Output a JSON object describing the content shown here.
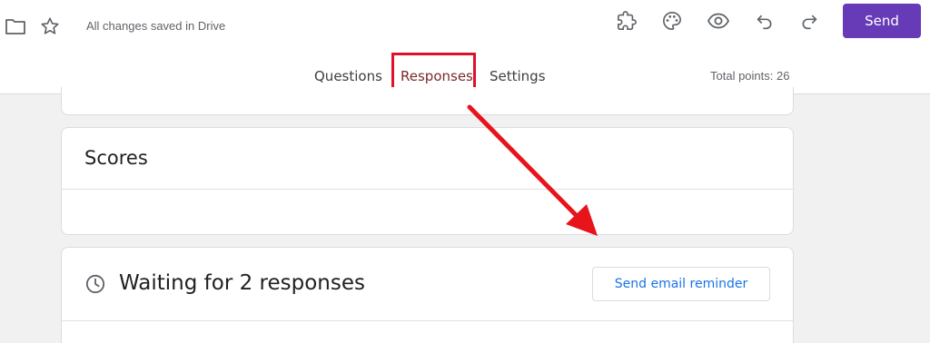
{
  "header": {
    "saved_status": "All changes saved in Drive",
    "send_label": "Send",
    "accent_color": "#673ab7"
  },
  "tabs": [
    {
      "label": "Questions",
      "active": false
    },
    {
      "label": "Responses",
      "active": true
    },
    {
      "label": "Settings",
      "active": false
    }
  ],
  "total_points": "Total points: 26",
  "scores": {
    "title": "Scores"
  },
  "waiting": {
    "title": "Waiting for 2 responses",
    "reminder_label": "Send email reminder"
  },
  "icons": [
    "folder-icon",
    "star-icon",
    "add-ons-icon",
    "palette-icon",
    "preview-eye-icon",
    "undo-icon",
    "redo-icon",
    "clock-icon"
  ],
  "annotation": {
    "highlight_color": "#e0102a"
  }
}
